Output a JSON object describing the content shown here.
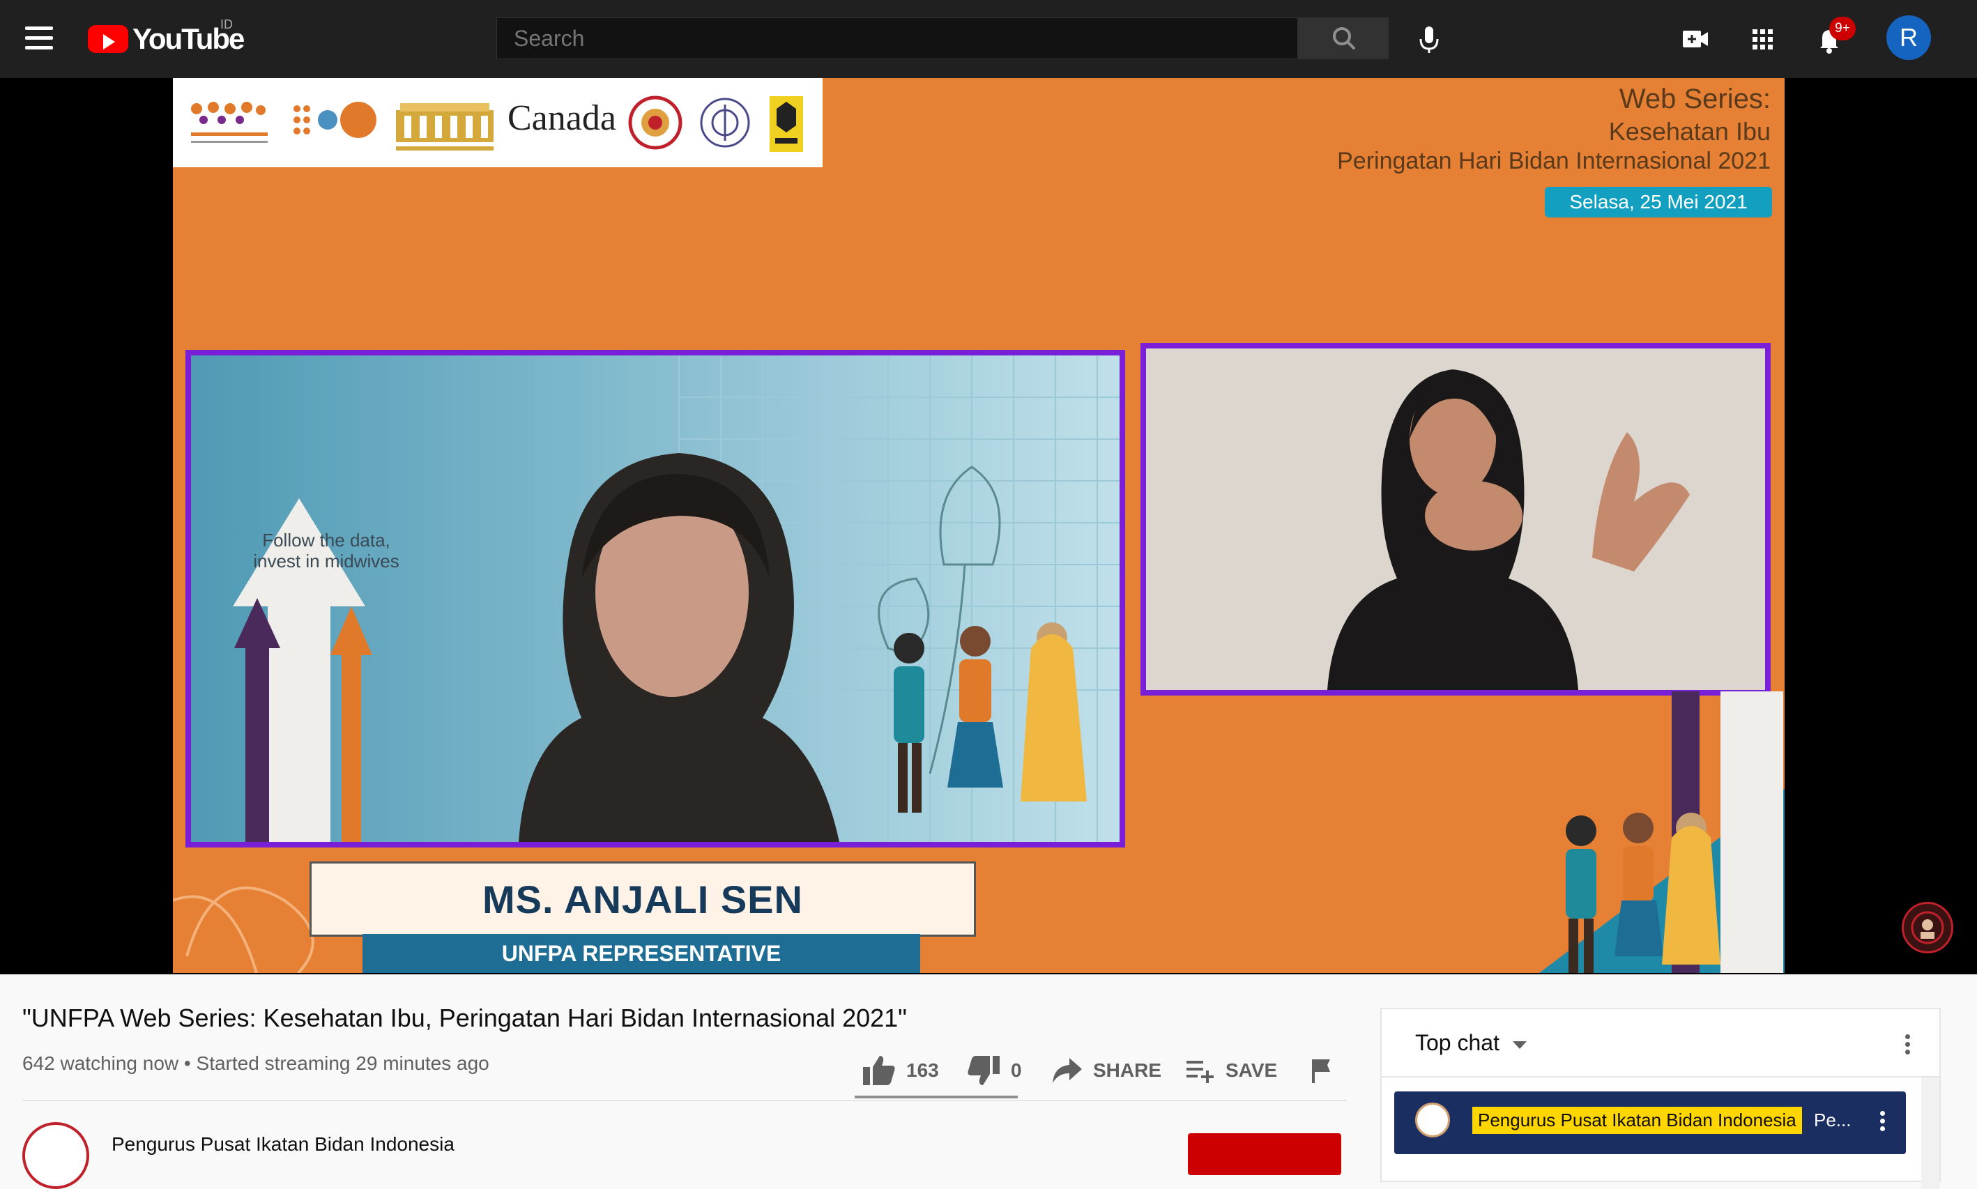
{
  "header": {
    "logo_text": "YouTube",
    "country_code": "ID",
    "search_placeholder": "Search",
    "notification_count": "9+",
    "avatar_letter": "R"
  },
  "video": {
    "overlay": {
      "canada_text": "Canada",
      "web_series_title": "Web Series:",
      "web_series_topic": "Kesehatan Ibu",
      "web_series_event": "Peringatan Hari Bidan Internasional 2021",
      "date": "Selasa, 25 Mei 2021",
      "slide_text_line1": "Follow the data,",
      "slide_text_line2": "invest in midwives",
      "speaker_name": "MS. ANJALI SEN",
      "speaker_role": "UNFPA REPRESENTATIVE"
    }
  },
  "info": {
    "title": "\"UNFPA Web Series: Kesehatan Ibu, Peringatan Hari Bidan Internasional 2021\"",
    "meta": "642 watching now • Started streaming 29 minutes ago",
    "likes": "163",
    "dislikes": "0",
    "share_label": "SHARE",
    "save_label": "SAVE",
    "channel_name": "Pengurus Pusat Ikatan Bidan Indonesia"
  },
  "chat": {
    "mode_label": "Top chat",
    "pinned_author": "Pengurus Pusat Ikatan Bidan Indonesia",
    "pinned_message": "Pe..."
  },
  "colors": {
    "brand_red": "#ff0000",
    "subscribe_red": "#cc0000",
    "masthead_bg": "#202020",
    "video_orange": "#e58035",
    "frame_purple": "#7a1fd8"
  }
}
